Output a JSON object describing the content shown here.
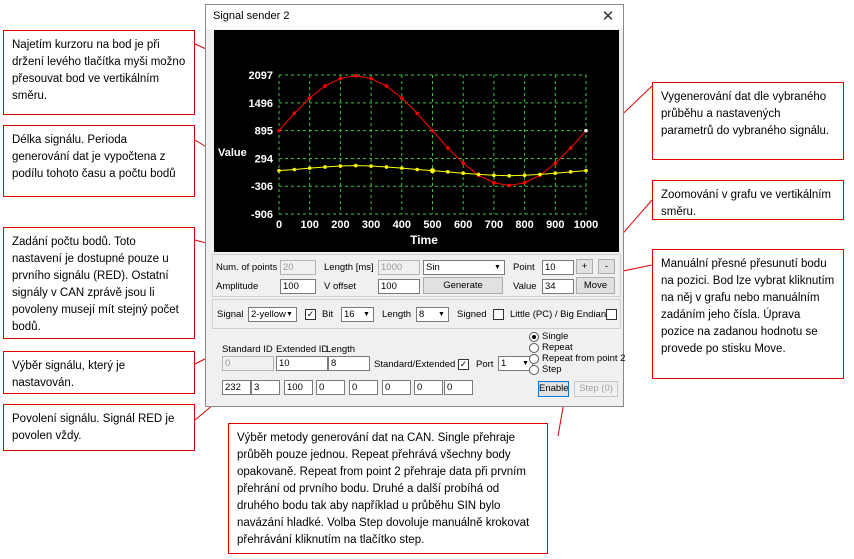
{
  "window": {
    "title": "Signal sender 2",
    "close_glyph": "✕"
  },
  "chart": {
    "xlabel": "Time",
    "ylabel": "Value",
    "ytick_labels": [
      "2097",
      "1496",
      "895",
      "294",
      "-306",
      "-906"
    ],
    "xtick_labels": [
      "0",
      "100",
      "200",
      "300",
      "400",
      "500",
      "600",
      "700",
      "800",
      "900",
      "1000"
    ]
  },
  "chart_data": {
    "type": "line",
    "xlabel": "Time",
    "ylabel": "Value",
    "x": [
      0,
      50,
      100,
      150,
      200,
      250,
      300,
      350,
      400,
      450,
      500,
      550,
      600,
      650,
      700,
      750,
      800,
      850,
      900,
      950,
      1000
    ],
    "ylim": [
      -906,
      2097
    ],
    "xlim": [
      0,
      1000
    ],
    "grid": true,
    "series": [
      {
        "color": "#ff0000",
        "values": [
          895,
          1270,
          1600,
          1860,
          2020,
          2080,
          2020,
          1860,
          1600,
          1270,
          895,
          520,
          190,
          -70,
          -230,
          -290,
          -230,
          -70,
          190,
          520,
          895
        ]
      },
      {
        "color": "#ffff00",
        "values": [
          30,
          55,
          85,
          110,
          130,
          140,
          130,
          110,
          85,
          55,
          30,
          5,
          -25,
          -50,
          -70,
          -80,
          -70,
          -50,
          -25,
          5,
          30
        ]
      }
    ]
  },
  "row1": {
    "num_points_label": "Num. of points",
    "num_points_value": "20",
    "length_label": "Length [ms]",
    "length_value": "1000",
    "waveform": "Sin",
    "point_label": "Point",
    "point_value": "10",
    "plus": "+",
    "minus": "-"
  },
  "row2": {
    "amplitude_label": "Amplitude",
    "amplitude_value": "100",
    "voffset_label": "V offset",
    "voffset_value": "100",
    "generate": "Generate",
    "value_label": "Value",
    "value_value": "34",
    "move": "Move"
  },
  "row3": {
    "signal_label": "Signal",
    "signal_value": "2-yellow",
    "bit_label": "Bit",
    "bit_value": "16",
    "length_label": "Length",
    "length_value": "8",
    "signed_label": "Signed",
    "endian_label": "Little (PC) / Big Endian",
    "check_mark": "✓"
  },
  "can": {
    "std_id_label": "Standard ID",
    "std_id_value": "0",
    "ext_id_label": "Extended ID",
    "ext_id_value": "10",
    "length_label": "Length",
    "length_value": "8",
    "std_ext_label": "Standard/Extended",
    "port_label": "Port",
    "port_value": "1",
    "bytes": [
      "232",
      "3",
      "100",
      "0",
      "0",
      "0",
      "0",
      "0"
    ]
  },
  "mode": {
    "options": [
      "Single",
      "Repeat",
      "Repeat from point 2",
      "Step"
    ],
    "enable": "Enable",
    "step": "Step (0)"
  },
  "callouts": {
    "c1": "Najetím kurzoru na bod je při držení levého tlačítka myši možno přesouvat bod ve vertikálním směru.",
    "c2": "Délka signálu. Perioda generování dat je vypočtena z podílu tohoto času a počtu bodů",
    "c3": "Zadání počtu bodů. Toto nastavení je dostupné pouze u prvního signálu (RED). Ostatní signály v CAN zprávě jsou li povoleny musejí mít stejný počet bodů.",
    "c4": "Výběr signálu, který je nastavován.",
    "c5": "Povolení signálu. Signál RED je povolen vždy.",
    "c6": "Výběr metody generování dat na CAN. Single přehraje průběh pouze jednou. Repeat přehrává všechny body opakovaně. Repeat from point 2 přehraje data při prvním přehrání od prvního bodu. Druhé a další probíhá od druhého bodu tak aby například u průběhu SIN bylo navázání hladké. Volba Step dovoluje manuálně krokovat přehrávání kliknutím na tlačítko step.",
    "c7": "Vygenerování dat dle vybraného průběhu a nastavených parametrů do vybraného signálu.",
    "c8": "Zoomování v grafu ve vertikálním směru.",
    "c9": "Manuální přesné přesunutí bodu na pozici. Bod lze vybrat kliknutím na něj v grafu nebo manuálním zadáním jeho čísla. Úprava pozice na zadanou hodnotu se provede po stisku Move."
  }
}
